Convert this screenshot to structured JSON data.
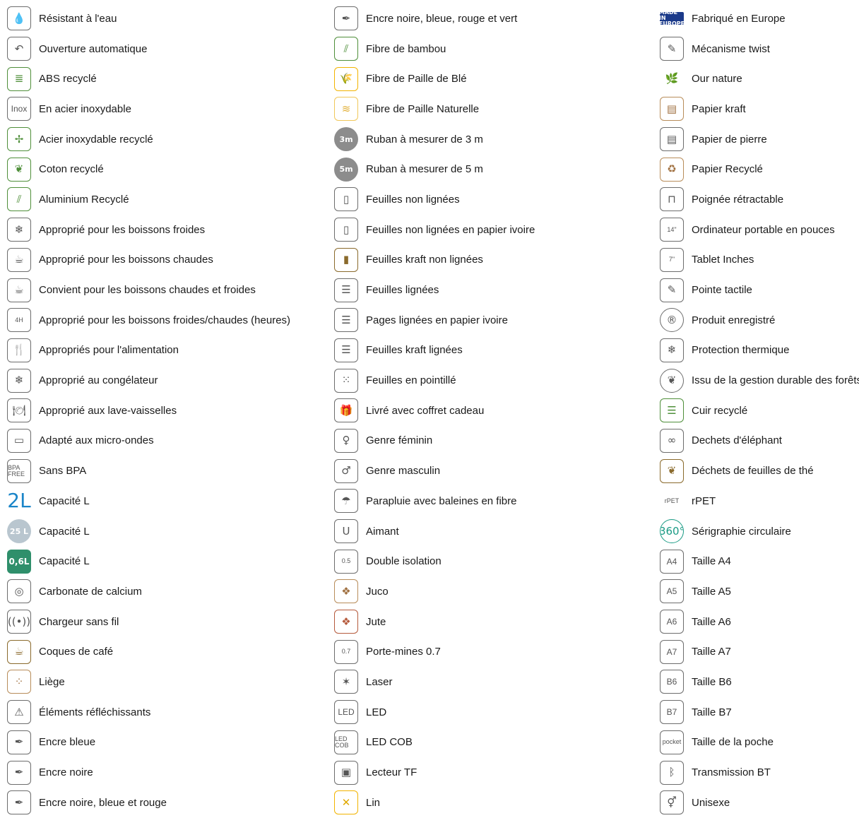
{
  "columns": [
    {
      "items": [
        {
          "label": "Résistant à l'eau",
          "icon": "water-drop-icon",
          "glyph": "💧"
        },
        {
          "label": "Ouverture automatique",
          "icon": "automatic-opening-icon",
          "glyph": "↶"
        },
        {
          "label": "ABS recyclé",
          "icon": "recycled-abs-icon",
          "glyph": "≣"
        },
        {
          "label": "En acier inoxydable",
          "icon": "inox-icon",
          "glyph": "Inox"
        },
        {
          "label": "Acier inoxydable recyclé",
          "icon": "recycled-stainless-steel-icon",
          "glyph": "✢"
        },
        {
          "label": "Coton recyclé",
          "icon": "recycled-cotton-icon",
          "glyph": "❦"
        },
        {
          "label": "Aluminium Recyclé",
          "icon": "recycled-aluminium-icon",
          "glyph": "⫽"
        },
        {
          "label": "Approprié pour les boissons froides",
          "icon": "cold-drinks-icon",
          "glyph": "❄"
        },
        {
          "label": "Approprié pour les boissons chaudes",
          "icon": "hot-drinks-icon",
          "glyph": "☕"
        },
        {
          "label": "Convient pour les boissons chaudes et froides",
          "icon": "hot-cold-drinks-icon",
          "glyph": "☕"
        },
        {
          "label": "Approprié pour les boissons froides/chaudes (heures)",
          "icon": "hours-hot-cold-icon",
          "glyph": "4H"
        },
        {
          "label": "Appropriés pour l'alimentation",
          "icon": "food-safe-icon",
          "glyph": "🍴"
        },
        {
          "label": "Approprié au congélateur",
          "icon": "freezer-icon",
          "glyph": "❄"
        },
        {
          "label": "Approprié aux lave-vaisselles",
          "icon": "dishwasher-icon",
          "glyph": "🍽"
        },
        {
          "label": "Adapté aux micro-ondes",
          "icon": "microwave-icon",
          "glyph": "▭"
        },
        {
          "label": "Sans BPA",
          "icon": "bpa-free-icon",
          "glyph": "BPA FREE"
        },
        {
          "label": "Capacité L",
          "icon": "capacity-2l-icon",
          "glyph": "2L"
        },
        {
          "label": "Capacité L",
          "icon": "capacity-25l-icon",
          "glyph": "25 L"
        },
        {
          "label": "Capacité L",
          "icon": "capacity-06l-icon",
          "glyph": "0,6L"
        },
        {
          "label": "Carbonate de calcium",
          "icon": "calcium-carbonate-icon",
          "glyph": "◎"
        },
        {
          "label": "Chargeur sans fil",
          "icon": "wireless-charger-icon",
          "glyph": "((•))"
        },
        {
          "label": "Coques de café",
          "icon": "coffee-husk-icon",
          "glyph": "☕"
        },
        {
          "label": "Liège",
          "icon": "cork-icon",
          "glyph": "⁘"
        },
        {
          "label": "Éléments réfléchissants",
          "icon": "reflective-icon",
          "glyph": "⚠"
        },
        {
          "label": "Encre bleue",
          "icon": "blue-ink-icon",
          "glyph": "✒"
        },
        {
          "label": "Encre noire",
          "icon": "black-ink-icon",
          "glyph": "✒"
        },
        {
          "label": "Encre noire, bleue et rouge",
          "icon": "three-ink-icon",
          "glyph": "✒"
        }
      ]
    },
    {
      "items": [
        {
          "label": "Encre noire, bleue, rouge et vert",
          "icon": "four-ink-icon",
          "glyph": "✒"
        },
        {
          "label": "Fibre de bambou",
          "icon": "bamboo-fibre-icon",
          "glyph": "⫽"
        },
        {
          "label": "Fibre de Paille de Blé",
          "icon": "wheat-straw-icon",
          "glyph": "🌾"
        },
        {
          "label": "Fibre de Paille Naturelle",
          "icon": "natural-straw-icon",
          "glyph": "≋"
        },
        {
          "label": "Ruban à mesurer de 3 m",
          "icon": "tape-3m-icon",
          "glyph": "3m"
        },
        {
          "label": "Ruban à mesurer de 5 m",
          "icon": "tape-5m-icon",
          "glyph": "5m"
        },
        {
          "label": "Feuilles non lignées",
          "icon": "blank-sheets-icon",
          "glyph": "▯"
        },
        {
          "label": "Feuilles non lignées en papier ivoire",
          "icon": "ivory-blank-sheets-icon",
          "glyph": "▯"
        },
        {
          "label": "Feuilles kraft non lignées",
          "icon": "kraft-blank-sheets-icon",
          "glyph": "▮"
        },
        {
          "label": "Feuilles lignées",
          "icon": "lined-sheets-icon",
          "glyph": "☰"
        },
        {
          "label": "Pages lignées en papier ivoire",
          "icon": "ivory-lined-sheets-icon",
          "glyph": "☰"
        },
        {
          "label": "Feuilles kraft lignées",
          "icon": "kraft-lined-sheets-icon",
          "glyph": "☰"
        },
        {
          "label": "Feuilles en pointillé",
          "icon": "dotted-sheets-icon",
          "glyph": "⁙"
        },
        {
          "label": "Livré avec coffret cadeau",
          "icon": "gift-box-icon",
          "glyph": "🎁"
        },
        {
          "label": "Genre féminin",
          "icon": "female-icon",
          "glyph": "♀"
        },
        {
          "label": "Genre masculin",
          "icon": "male-icon",
          "glyph": "♂"
        },
        {
          "label": "Parapluie avec baleines en fibre",
          "icon": "fiber-umbrella-icon",
          "glyph": "☂"
        },
        {
          "label": "Aimant",
          "icon": "magnet-icon",
          "glyph": "U"
        },
        {
          "label": "Double isolation",
          "icon": "double-insulation-icon",
          "glyph": "0.5"
        },
        {
          "label": "Juco",
          "icon": "juco-icon",
          "glyph": "❖"
        },
        {
          "label": "Jute",
          "icon": "jute-icon",
          "glyph": "❖"
        },
        {
          "label": "Porte-mines 0.7",
          "icon": "mechanical-pencil-icon",
          "glyph": "0.7"
        },
        {
          "label": "Laser",
          "icon": "laser-icon",
          "glyph": "✶"
        },
        {
          "label": "LED",
          "icon": "led-icon",
          "glyph": "LED"
        },
        {
          "label": "LED COB",
          "icon": "led-cob-icon",
          "glyph": "LED COB"
        },
        {
          "label": "Lecteur TF",
          "icon": "tf-reader-icon",
          "glyph": "▣"
        },
        {
          "label": "Lin",
          "icon": "linen-icon",
          "glyph": "✕"
        }
      ]
    },
    {
      "items": [
        {
          "label": "Fabriqué en Europe",
          "icon": "made-in-europe-icon",
          "glyph": "MADE IN EUROPE"
        },
        {
          "label": "Mécanisme twist",
          "icon": "twist-mechanism-icon",
          "glyph": "✎"
        },
        {
          "label": "Our nature",
          "icon": "our-nature-icon",
          "glyph": "🌿"
        },
        {
          "label": "Papier kraft",
          "icon": "kraft-paper-icon",
          "glyph": "▤"
        },
        {
          "label": "Papier de pierre",
          "icon": "stone-paper-icon",
          "glyph": "▤"
        },
        {
          "label": "Papier Recyclé",
          "icon": "recycled-paper-icon",
          "glyph": "♻"
        },
        {
          "label": "Poignée rétractable",
          "icon": "retractable-handle-icon",
          "glyph": "⊓"
        },
        {
          "label": "Ordinateur portable en pouces",
          "icon": "laptop-inches-icon",
          "glyph": "14\""
        },
        {
          "label": "Tablet Inches",
          "icon": "tablet-inches-icon",
          "glyph": "7\""
        },
        {
          "label": "Pointe tactile",
          "icon": "touch-tip-icon",
          "glyph": "✎"
        },
        {
          "label": "Produit enregistré",
          "icon": "patented-icon",
          "glyph": "®"
        },
        {
          "label": "Protection thermique",
          "icon": "thermal-protection-icon",
          "glyph": "❄"
        },
        {
          "label": "Issu de la gestion durable des forêts",
          "icon": "sustainable-forest-icon",
          "glyph": "❦"
        },
        {
          "label": "Cuir recyclé",
          "icon": "recycled-leather-icon",
          "glyph": "☰"
        },
        {
          "label": "Dechets d'éléphant",
          "icon": "elephant-waste-icon",
          "glyph": "∞"
        },
        {
          "label": "Déchets de feuilles de thé",
          "icon": "tea-leaf-waste-icon",
          "glyph": "❦"
        },
        {
          "label": "rPET",
          "icon": "rpet-icon",
          "glyph": "rPET"
        },
        {
          "label": "Sérigraphie circulaire",
          "icon": "circular-print-icon",
          "glyph": "360°"
        },
        {
          "label": "Taille A4",
          "icon": "size-a4-icon",
          "glyph": "A4"
        },
        {
          "label": "Taille A5",
          "icon": "size-a5-icon",
          "glyph": "A5"
        },
        {
          "label": "Taille A6",
          "icon": "size-a6-icon",
          "glyph": "A6"
        },
        {
          "label": "Taille A7",
          "icon": "size-a7-icon",
          "glyph": "A7"
        },
        {
          "label": "Taille B6",
          "icon": "size-b6-icon",
          "glyph": "B6"
        },
        {
          "label": "Taille B7",
          "icon": "size-b7-icon",
          "glyph": "B7"
        },
        {
          "label": "Taille de la poche",
          "icon": "pocket-size-icon",
          "glyph": "pocket"
        },
        {
          "label": "Transmission BT",
          "icon": "bluetooth-icon",
          "glyph": "ᛒ"
        },
        {
          "label": "Unisexe",
          "icon": "unisex-icon",
          "glyph": "⚥"
        }
      ]
    }
  ]
}
